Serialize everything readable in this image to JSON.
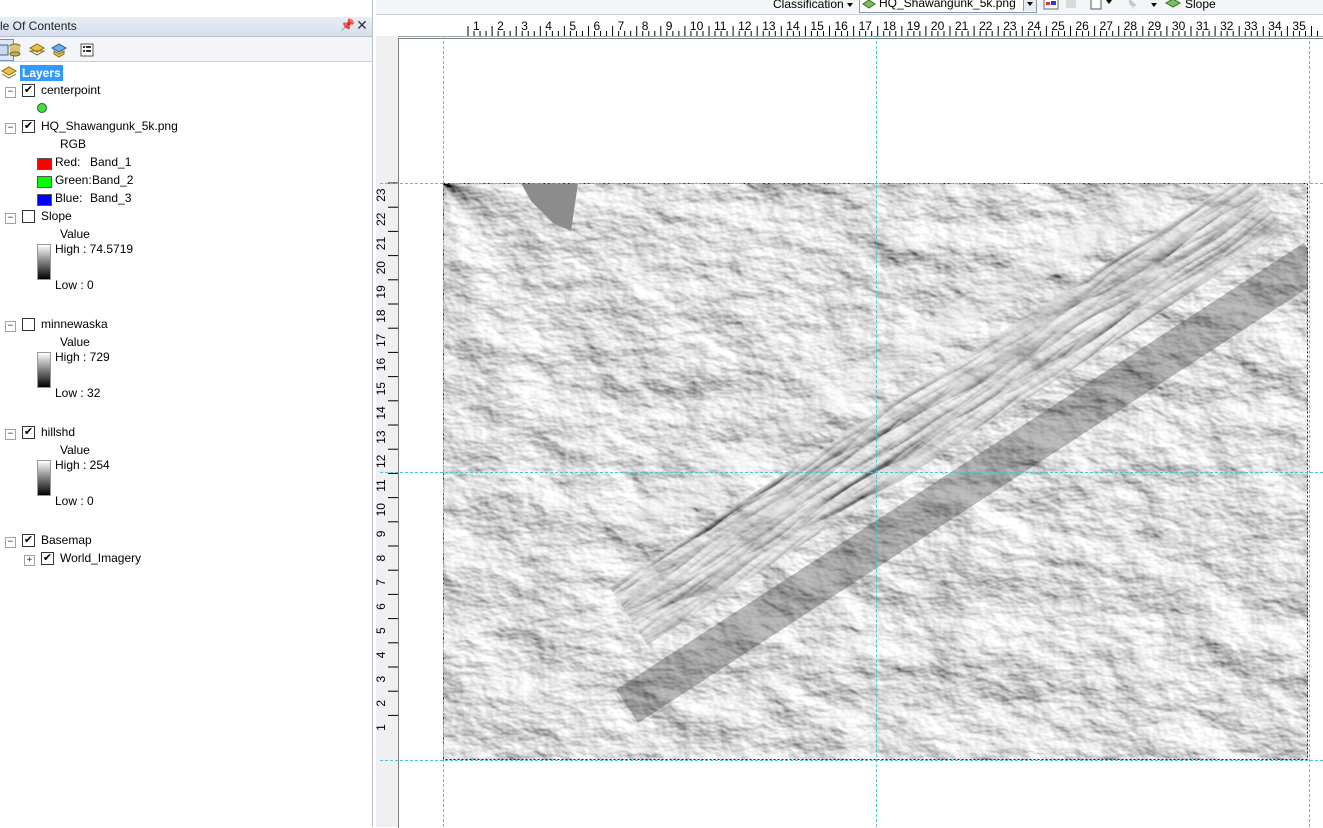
{
  "toc": {
    "title": "le Of Contents",
    "root_label": "Layers",
    "layers": [
      {
        "name": "centerpoint",
        "checked": true
      },
      {
        "name": "HQ_Shawangunk_5k.png",
        "checked": true,
        "legend_header": "RGB",
        "bands": [
          {
            "label": "Red:",
            "band": "Band_1",
            "color": "#ff0000"
          },
          {
            "label": "Green:",
            "band": "Band_2",
            "color": "#00ff00"
          },
          {
            "label": "Blue:",
            "band": "Band_3",
            "color": "#0000ff"
          }
        ]
      },
      {
        "name": "Slope",
        "checked": false,
        "value_label": "Value",
        "high": "High : 74.5719",
        "low": "Low : 0"
      },
      {
        "name": "minnewaska",
        "checked": false,
        "value_label": "Value",
        "high": "High : 729",
        "low": "Low : 32"
      },
      {
        "name": "hillshd",
        "checked": true,
        "value_label": "Value",
        "high": "High : 254",
        "low": "Low : 0"
      },
      {
        "name": "Basemap",
        "checked": true,
        "sublayers": [
          {
            "name": "World_Imagery",
            "checked": true
          }
        ]
      }
    ],
    "point_symbol_color": "#44dd44"
  },
  "toolbar": {
    "classification_label": "Classification",
    "layer_combo_value": "HQ_Shawangunk_5k.png",
    "slope_label": "Slope"
  },
  "ruler": {
    "h_labels": [
      "1",
      "2",
      "3",
      "4",
      "5",
      "6",
      "7",
      "8",
      "9",
      "10",
      "11",
      "12",
      "13",
      "14",
      "15",
      "16",
      "17",
      "18",
      "19",
      "20",
      "21",
      "22",
      "23",
      "24",
      "25",
      "26",
      "27",
      "28",
      "29",
      "30",
      "31",
      "32",
      "33",
      "34",
      "35"
    ],
    "v_labels": [
      "23",
      "22",
      "21",
      "20",
      "19",
      "18",
      "17",
      "16",
      "15",
      "14",
      "13",
      "12",
      "11",
      "10",
      "9",
      "8",
      "7",
      "6",
      "5",
      "4",
      "3",
      "2",
      "1"
    ]
  },
  "colors": {
    "guide": "#4fc3d6",
    "selection": "#3399ff"
  }
}
